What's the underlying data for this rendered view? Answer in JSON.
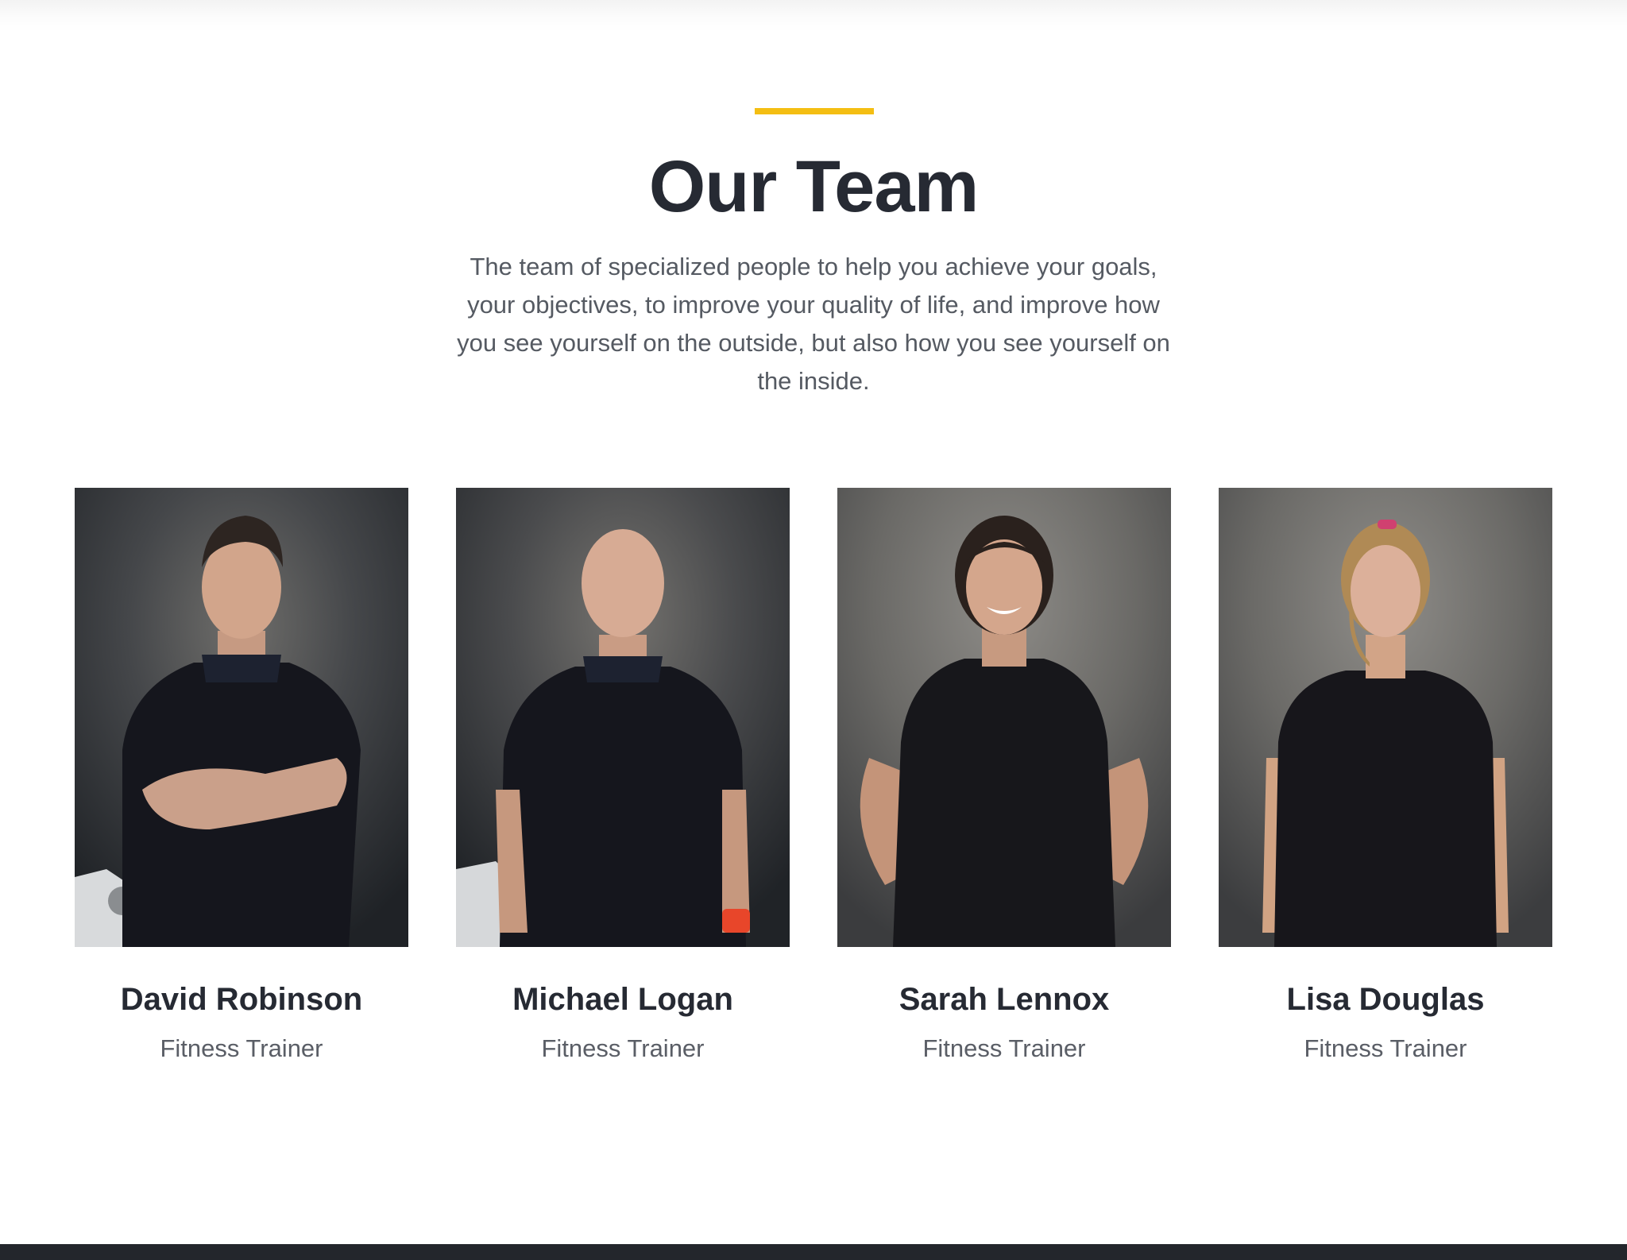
{
  "section": {
    "title": "Our Team",
    "description": "The team of specialized people to help you achieve your goals, your objectives, to improve your quality of life, and improve how you see yourself on the outside, but also how you see yourself on the inside.",
    "accent_color": "#f4be13"
  },
  "team": [
    {
      "name": "David Robinson",
      "role": "Fitness Trainer"
    },
    {
      "name": "Michael Logan",
      "role": "Fitness Trainer"
    },
    {
      "name": "Sarah Lennox",
      "role": "Fitness Trainer"
    },
    {
      "name": "Lisa Douglas",
      "role": "Fitness Trainer"
    }
  ]
}
